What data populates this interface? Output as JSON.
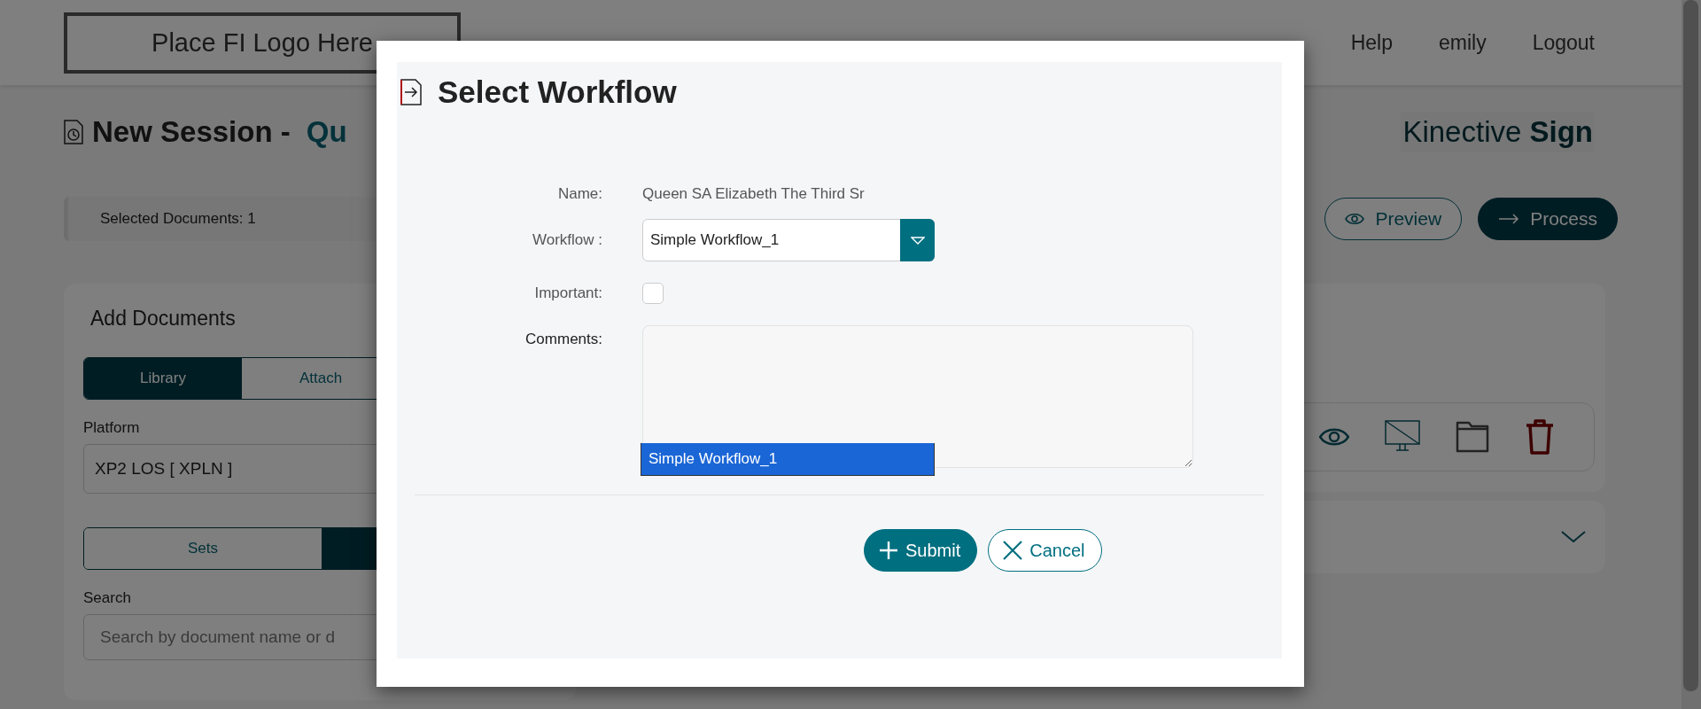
{
  "header": {
    "logo": "Place FI Logo Here",
    "nav": [
      "Help",
      "emily",
      "Logout"
    ]
  },
  "page": {
    "title": "New Session -",
    "title_name": "Qu",
    "brand": "Kinective",
    "brand_bold": "Sign"
  },
  "toolbar": {
    "selected_documents": "Selected Documents: 1",
    "buttons": [
      {
        "kind": "outline",
        "label": "Preview"
      },
      {
        "kind": "solid",
        "label": "Process"
      }
    ]
  },
  "add_documents": {
    "title": "Add Documents",
    "source_tabs": [
      {
        "label": "Library",
        "selected": true
      },
      {
        "label": "Attach",
        "selected": false
      }
    ],
    "platform_label": "Platform",
    "platform_value": "XP2 LOS [ XPLN ]",
    "set_tabs": [
      {
        "label": "Sets",
        "selected": false
      },
      {
        "selected": true
      }
    ],
    "search_label": "Search",
    "search_placeholder": "Search by document name or d"
  },
  "dialog": {
    "title": "Select Workflow",
    "name_label": "Name:",
    "name_value": "Queen SA Elizabeth The Third Sr",
    "workflow_label": "Workflow :",
    "workflow_value": "Simple Workflow_1",
    "workflow_open": true,
    "workflow_options": [
      {
        "label": "Simple Workflow_1",
        "selected": true
      }
    ],
    "important_label": "Important:",
    "important_checked": false,
    "comments_label": "Comments:",
    "buttons": [
      {
        "kind": "submit",
        "label": "Submit"
      },
      {
        "kind": "cancel",
        "label": "Cancel"
      }
    ]
  }
}
